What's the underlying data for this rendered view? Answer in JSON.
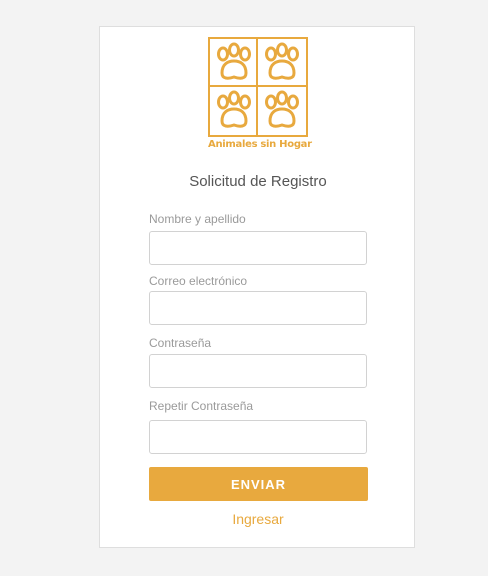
{
  "brand": {
    "logo_text": "Animales sin Hogar",
    "accent_color": "#e8a93e",
    "logo_icon": "paw-icon"
  },
  "form": {
    "title": "Solicitud de Registro",
    "fields": [
      {
        "label": "Nombre y apellido",
        "value": ""
      },
      {
        "label": "Correo electrónico",
        "value": ""
      },
      {
        "label": "Contraseña",
        "value": ""
      },
      {
        "label": "Repetir Contraseña",
        "value": ""
      }
    ],
    "submit_label": "ENVIAR",
    "login_link": "Ingresar"
  }
}
